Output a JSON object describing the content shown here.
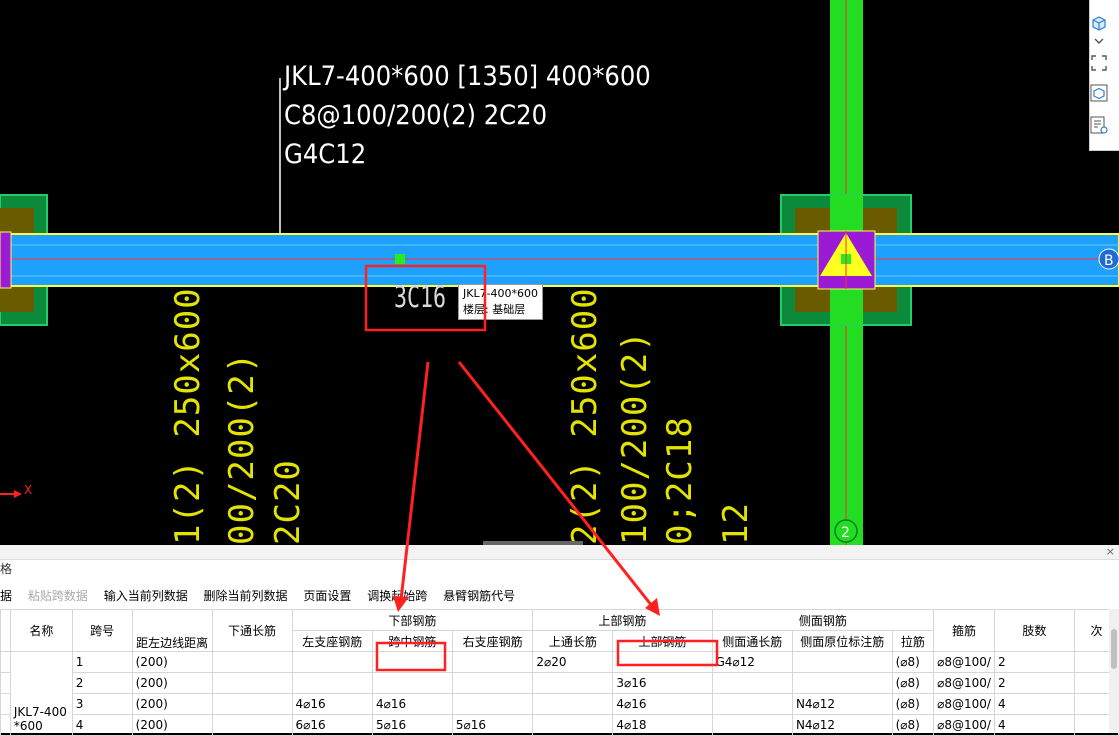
{
  "cad": {
    "beam_label": {
      "line1": "JKL7-400*600 [1350] 400*600",
      "line2": "C8@100/200(2) 2C20",
      "line3": "G4C12"
    },
    "bottom_rebar_text": "3C16",
    "tooltip": {
      "line1": "JKL7-400*600",
      "line2": "楼层: 基础层"
    },
    "vertical_texts": [
      "1(2) 250x600",
      "00/200(2)",
      "2C20",
      "2(2) 250x600",
      "100/200(2)",
      "0;2C18",
      "12"
    ],
    "axis_x_label": "X",
    "grid_bubble_b": "B",
    "grid_bubble_2": "2"
  },
  "panel": {
    "title": "格",
    "close": "×",
    "toolbar": [
      {
        "label": "据",
        "disabled": false
      },
      {
        "label": "粘贴跨数据",
        "disabled": true
      },
      {
        "label": "输入当前列数据",
        "disabled": false
      },
      {
        "label": "删除当前列数据",
        "disabled": false
      },
      {
        "label": "页面设置",
        "disabled": false
      },
      {
        "label": "调换起始跨",
        "disabled": false
      },
      {
        "label": "悬臂钢筋代号",
        "disabled": false
      }
    ],
    "groups": {
      "bottom": "下部钢筋",
      "top": "上部钢筋",
      "side": "侧面钢筋"
    },
    "headers": {
      "name": "名称",
      "span": "跨号",
      "dist": "距左边线距离",
      "bottom_through": "下通长筋",
      "b_left": "左支座钢筋",
      "b_mid": "跨中钢筋",
      "b_right": "右支座钢筋",
      "t_through": "上通长筋",
      "t_rebar": "上部钢筋",
      "s_through": "侧面通长筋",
      "s_orig": "侧面原位标注筋",
      "tie": "拉筋",
      "stirrup": "箍筋",
      "legs": "肢数",
      "next": "次"
    },
    "name_cell": {
      "line1": "JKL7-400",
      "line2": "*600"
    },
    "rows": [
      {
        "span": "1",
        "dist": "(200)",
        "bt": "",
        "bl": "",
        "bm": "",
        "br": "",
        "tt": "2⌀20",
        "tr": "",
        "st": "G4⌀12",
        "so": "",
        "tie": "(⌀8)",
        "stirrup": "⌀8@100/",
        "legs": "2"
      },
      {
        "span": "2",
        "dist": "(200)",
        "bt": "",
        "bl": "",
        "bm": "",
        "br": "",
        "tt": "",
        "tr": "3⌀16",
        "st": "",
        "so": "",
        "tie": "(⌀8)",
        "stirrup": "⌀8@100/",
        "legs": "2"
      },
      {
        "span": "3",
        "dist": "(200)",
        "bt": "",
        "bl": "4⌀16",
        "bm": "4⌀16",
        "br": "",
        "tt": "",
        "tr": "4⌀16",
        "st": "",
        "so": "N4⌀12",
        "tie": "(⌀8)",
        "stirrup": "⌀8@100/",
        "legs": "4"
      },
      {
        "span": "4",
        "dist": "(200)",
        "bt": "",
        "bl": "6⌀16",
        "bm": "5⌀16",
        "br": "5⌀16",
        "tt": "",
        "tr": "4⌀18",
        "st": "",
        "so": "N4⌀12",
        "tie": "(⌀8)",
        "stirrup": "⌀8@100/",
        "legs": "4"
      }
    ]
  },
  "colors": {
    "beam_blue": "#1ea0ff",
    "beam_edge": "#ffff40",
    "column_green": "#22cc22",
    "annotation_red": "#ff2020",
    "text_yellow": "#e3e300"
  }
}
